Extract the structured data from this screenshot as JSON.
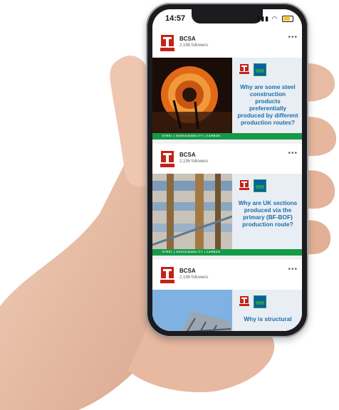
{
  "status_bar": {
    "time": "14:57"
  },
  "feed": {
    "posts": [
      {
        "org": "BCSA",
        "followers": "2,196 followers",
        "headline": "Why are some steel construction products preferentially produced by different production routes?",
        "tags": "STEEL | SUSTAINABILITY | CARBON"
      },
      {
        "org": "BCSA",
        "followers": "2,196 followers",
        "headline": "Why are UK sections produced via the primary (BF-BOF) production route?",
        "tags": "STEEL | SUSTAINABILITY | CARBON"
      },
      {
        "org": "BCSA",
        "followers": "2,196 followers",
        "headline": "Why is structural",
        "tags": ""
      }
    ]
  },
  "colors": {
    "accent_green": "#169a48",
    "headline_blue": "#1d6fa8",
    "logo_red": "#c4231a"
  },
  "icons": [
    "bcsa-logo-icon",
    "more-options-icon",
    "signal-icon",
    "wifi-icon",
    "battery-icon",
    "certification-badge-icon"
  ]
}
